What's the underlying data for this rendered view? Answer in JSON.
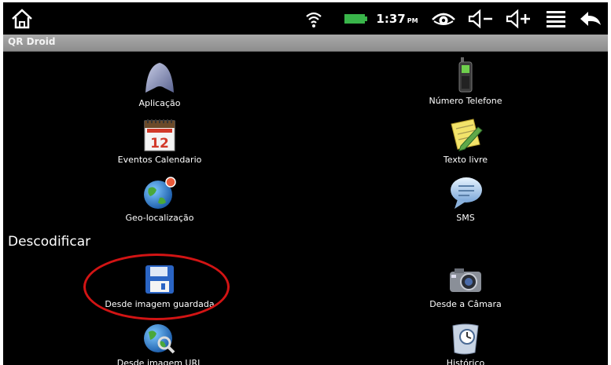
{
  "status_bar": {
    "time": "1:37",
    "ampm": "PM"
  },
  "app": {
    "title": "QR Droid"
  },
  "encode_items": [
    {
      "label": "Aplicação",
      "icon": "android-app-icon"
    },
    {
      "label": "Número Telefone",
      "icon": "phone-icon"
    },
    {
      "label": "Eventos Calendario",
      "icon": "calendar-icon"
    },
    {
      "label": "Texto livre",
      "icon": "note-pencil-icon"
    },
    {
      "label": "Geo-localização",
      "icon": "globe-location-icon"
    },
    {
      "label": "SMS",
      "icon": "speech-bubble-icon"
    }
  ],
  "decode": {
    "header": "Descodificar",
    "items": [
      {
        "label": "Desde imagem guardada",
        "icon": "floppy-disk-icon"
      },
      {
        "label": "Desde a Câmara",
        "icon": "camera-icon"
      },
      {
        "label": "Desde imagem URL",
        "icon": "globe-search-icon"
      },
      {
        "label": "Histórico",
        "icon": "scroll-clock-icon"
      }
    ]
  },
  "calendar_day": "12",
  "colors": {
    "highlight": "#d21414",
    "battery": "#39b54a",
    "title_bar": "#9b9b9b"
  }
}
